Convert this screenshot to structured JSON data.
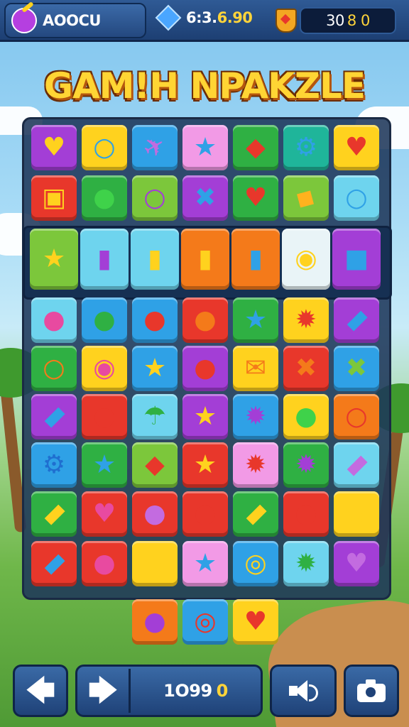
{
  "header": {
    "player_name": "AOOCU",
    "gems": "6:3.",
    "gems_highlight": "6.90",
    "score_white": "30",
    "score_gold": "8 0"
  },
  "title": "GAM!H NPAKZLE",
  "footer": {
    "score_white": "1O99",
    "score_gold": "0"
  },
  "colors": {
    "purple": "#a33ed6",
    "yellow": "#ffd21e",
    "blue": "#2fa1e6",
    "pink": "#f29ae6",
    "green": "#2fb043",
    "teal": "#1fb59a",
    "red": "#e8372b",
    "orange": "#f47a1a",
    "lime": "#7cc73b",
    "cyan": "#6ed4ee",
    "white": "#e9f4f7"
  },
  "board": {
    "rows": [
      [
        [
          "purple",
          "heart",
          "#ffd21e"
        ],
        [
          "yellow",
          "ring",
          "#2fa1e6"
        ],
        [
          "blue",
          "plane",
          "#c36be0"
        ],
        [
          "pink",
          "star",
          "#2fa1e6"
        ],
        [
          "green",
          "drop",
          "#e8372b"
        ],
        [
          "teal",
          "gear",
          "#2fa1e6"
        ],
        [
          "yellow",
          "heart",
          "#e8372b"
        ]
      ],
      [
        [
          "red",
          "cheese",
          "#ffd21e"
        ],
        [
          "green",
          "apple",
          "#3fd24a"
        ],
        [
          "lime",
          "ring",
          "#a33ed6"
        ],
        [
          "purple",
          "cross",
          "#2fa1e6"
        ],
        [
          "green",
          "heart",
          "#e8372b"
        ],
        [
          "lime",
          "tag",
          "#ffb21e"
        ],
        [
          "cyan",
          "ring",
          "#2fa1e6"
        ]
      ],
      [
        [
          "lime",
          "star",
          "#ffd21e"
        ],
        [
          "cyan",
          "cup",
          "#a33ed6"
        ],
        [
          "cyan",
          "bottle",
          "#ffd21e"
        ],
        [
          "orange",
          "bottle",
          "#ffd21e"
        ],
        [
          "orange",
          "bottle",
          "#2fa1e6"
        ],
        [
          "white",
          "pin",
          "#ffd21e"
        ],
        [
          "purple",
          "cube",
          "#2fa1e6"
        ]
      ],
      [
        [
          "cyan",
          "apple",
          "#e84aa0"
        ],
        [
          "blue",
          "apple",
          "#2fb043"
        ],
        [
          "blue",
          "apple",
          "#e8372b"
        ],
        [
          "red",
          "apple",
          "#f47a1a"
        ],
        [
          "green",
          "star",
          "#2fa1e6"
        ],
        [
          "yellow",
          "blob",
          "#e8372b"
        ],
        [
          "purple",
          "pill",
          "#2fa1e6"
        ]
      ],
      [
        [
          "green",
          "ring",
          "#f47a1a"
        ],
        [
          "yellow",
          "button",
          "#e84aa0"
        ],
        [
          "blue",
          "star",
          "#ffd21e"
        ],
        [
          "purple",
          "apple",
          "#e8372b"
        ],
        [
          "yellow",
          "mail",
          "#f47a1a"
        ],
        [
          "red",
          "cross",
          "#f47a1a"
        ],
        [
          "blue",
          "cross",
          "#7cc73b"
        ]
      ],
      [
        [
          "purple",
          "pill",
          "#2fa1e6"
        ],
        [
          "red",
          "apple",
          "#e8372b"
        ],
        [
          "cyan",
          "umbrella",
          "#2fb043"
        ],
        [
          "purple",
          "star",
          "#ffd21e"
        ],
        [
          "blue",
          "blob",
          "#a33ed6"
        ],
        [
          "yellow",
          "apple",
          "#3fd24a"
        ],
        [
          "orange",
          "ring",
          "#e8372b"
        ]
      ],
      [
        [
          "blue",
          "gear",
          "#1f6fd0"
        ],
        [
          "green",
          "star",
          "#2fa1e6"
        ],
        [
          "lime",
          "drop",
          "#e8372b"
        ],
        [
          "red",
          "star",
          "#ffd21e"
        ],
        [
          "pink",
          "blob",
          "#e8372b"
        ],
        [
          "green",
          "blob",
          "#a33ed6"
        ],
        [
          "cyan",
          "pill",
          "#c36be0"
        ]
      ],
      [
        [
          "green",
          "pill",
          "#ffd21e"
        ],
        [
          "red",
          "heart",
          "#e84aa0"
        ],
        [
          "red",
          "apple",
          "#c36be0"
        ],
        [
          "red",
          "apple",
          "#e8372b"
        ],
        [
          "green",
          "pill",
          "#ffd21e"
        ],
        [
          "red",
          "apple",
          "#e8372b"
        ],
        [
          "yellow",
          "star",
          "#ffd21e"
        ]
      ],
      [
        [
          "red",
          "pill",
          "#2fa1e6"
        ],
        [
          "red",
          "apple",
          "#e84aa0"
        ],
        [
          "yellow",
          "star",
          "#ffd21e"
        ],
        [
          "pink",
          "star",
          "#2fa1e6"
        ],
        [
          "blue",
          "coin",
          "#ffd21e"
        ],
        [
          "cyan",
          "blob",
          "#2fb043"
        ],
        [
          "purple",
          "heart",
          "#c36be0"
        ]
      ]
    ],
    "extra": [
      [
        "orange",
        "apple",
        "#a33ed6"
      ],
      [
        "blue",
        "target",
        "#e8372b"
      ],
      [
        "yellow",
        "heart",
        "#e8372b"
      ]
    ]
  }
}
